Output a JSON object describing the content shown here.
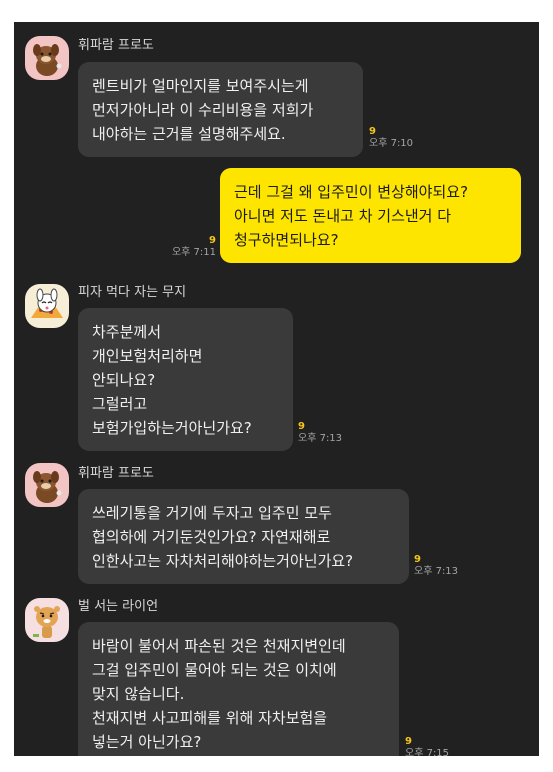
{
  "messages": [
    {
      "sender": "휘파람 프로도",
      "avatar": "frodo-whistle-avatar",
      "lines": [
        "렌트비가 얼마인지를 보여주시는게",
        "먼저가아니라 이 수리비용을 저희가",
        "내야하는 근거를 설명해주세요."
      ],
      "unread": "9",
      "time": "오후 7:10"
    },
    {
      "sender": "",
      "mine": true,
      "lines": [
        "근데 그걸 왜 입주민이 변상해야되요?",
        "아니면 저도 돈내고 차 기스낸거 다",
        "청구하면되나요?"
      ],
      "unread": "9",
      "time": "오후 7:11"
    },
    {
      "sender": "피자 먹다 자는 무지",
      "avatar": "muzi-pizza-avatar",
      "lines": [
        "차주분께서",
        "개인보험처리하면",
        "안되나요?",
        "그럴러고",
        "보험가입하는거아닌가요?"
      ],
      "unread": "9",
      "time": "오후 7:13"
    },
    {
      "sender": "휘파람 프로도",
      "avatar": "frodo-whistle-avatar",
      "lines": [
        "쓰레기통을 거기에 두자고 입주민 모두",
        "협의하에 거기둔것인가요? 자연재해로",
        "인한사고는 자차처리해야하는거아닌가요?"
      ],
      "unread": "9",
      "time": "오후 7:13"
    },
    {
      "sender": "벌 서는 라이언",
      "avatar": "ryan-punished-avatar",
      "lines": [
        "바람이 불어서 파손된 것은 천재지변인데",
        "그걸 입주민이 물어야 되는 것은 이치에",
        "맞지 않습니다.",
        "천재지변 사고피해를 위해 자차보험을",
        "넣는거 아닌가요?"
      ],
      "unread": "9",
      "time": "오후 7:15"
    }
  ]
}
